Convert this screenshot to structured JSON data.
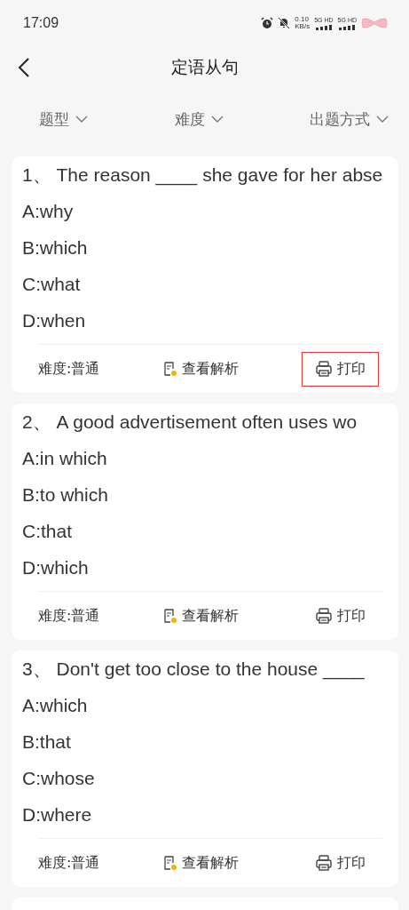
{
  "status_bar": {
    "time": "17:09",
    "net_speed": "0.10",
    "net_unit": "KB/s",
    "sims": [
      "5G HD",
      "5G HD"
    ]
  },
  "header": {
    "title": "定语从句"
  },
  "filters": [
    {
      "label": "题型"
    },
    {
      "label": "难度"
    },
    {
      "label": "出题方式"
    }
  ],
  "questions": [
    {
      "title": "1、 The reason ____ she gave for her abse",
      "options": [
        "A:why",
        "B:which",
        "C:what",
        "D:when"
      ],
      "difficulty": "难度:普通",
      "analysis": "查看解析",
      "print": {
        "label": "打印",
        "highlighted": true
      }
    },
    {
      "title": "2、 A good advertisement often uses wo",
      "options": [
        "A:in which",
        "B:to which",
        "C:that",
        "D:which"
      ],
      "difficulty": "难度:普通",
      "analysis": "查看解析",
      "print": {
        "label": "打印",
        "highlighted": false
      }
    },
    {
      "title": "3、 Don't get too close to the house ____",
      "options": [
        "A:which",
        "B:that",
        "C:whose",
        "D:where"
      ],
      "difficulty": "难度:普通",
      "analysis": "查看解析",
      "print": {
        "label": "打印",
        "highlighted": false
      }
    }
  ]
}
